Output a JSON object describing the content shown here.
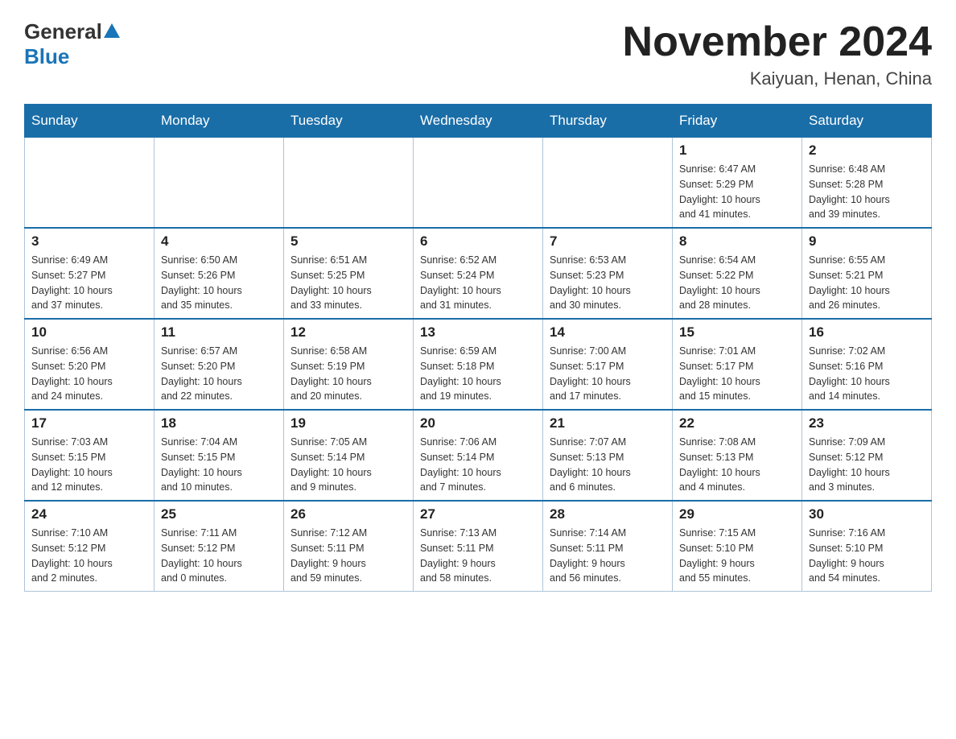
{
  "header": {
    "logo_general": "General",
    "logo_blue": "Blue",
    "title": "November 2024",
    "subtitle": "Kaiyuan, Henan, China"
  },
  "days": [
    "Sunday",
    "Monday",
    "Tuesday",
    "Wednesday",
    "Thursday",
    "Friday",
    "Saturday"
  ],
  "weeks": [
    [
      {
        "day": "",
        "info": ""
      },
      {
        "day": "",
        "info": ""
      },
      {
        "day": "",
        "info": ""
      },
      {
        "day": "",
        "info": ""
      },
      {
        "day": "",
        "info": ""
      },
      {
        "day": "1",
        "info": "Sunrise: 6:47 AM\nSunset: 5:29 PM\nDaylight: 10 hours\nand 41 minutes."
      },
      {
        "day": "2",
        "info": "Sunrise: 6:48 AM\nSunset: 5:28 PM\nDaylight: 10 hours\nand 39 minutes."
      }
    ],
    [
      {
        "day": "3",
        "info": "Sunrise: 6:49 AM\nSunset: 5:27 PM\nDaylight: 10 hours\nand 37 minutes."
      },
      {
        "day": "4",
        "info": "Sunrise: 6:50 AM\nSunset: 5:26 PM\nDaylight: 10 hours\nand 35 minutes."
      },
      {
        "day": "5",
        "info": "Sunrise: 6:51 AM\nSunset: 5:25 PM\nDaylight: 10 hours\nand 33 minutes."
      },
      {
        "day": "6",
        "info": "Sunrise: 6:52 AM\nSunset: 5:24 PM\nDaylight: 10 hours\nand 31 minutes."
      },
      {
        "day": "7",
        "info": "Sunrise: 6:53 AM\nSunset: 5:23 PM\nDaylight: 10 hours\nand 30 minutes."
      },
      {
        "day": "8",
        "info": "Sunrise: 6:54 AM\nSunset: 5:22 PM\nDaylight: 10 hours\nand 28 minutes."
      },
      {
        "day": "9",
        "info": "Sunrise: 6:55 AM\nSunset: 5:21 PM\nDaylight: 10 hours\nand 26 minutes."
      }
    ],
    [
      {
        "day": "10",
        "info": "Sunrise: 6:56 AM\nSunset: 5:20 PM\nDaylight: 10 hours\nand 24 minutes."
      },
      {
        "day": "11",
        "info": "Sunrise: 6:57 AM\nSunset: 5:20 PM\nDaylight: 10 hours\nand 22 minutes."
      },
      {
        "day": "12",
        "info": "Sunrise: 6:58 AM\nSunset: 5:19 PM\nDaylight: 10 hours\nand 20 minutes."
      },
      {
        "day": "13",
        "info": "Sunrise: 6:59 AM\nSunset: 5:18 PM\nDaylight: 10 hours\nand 19 minutes."
      },
      {
        "day": "14",
        "info": "Sunrise: 7:00 AM\nSunset: 5:17 PM\nDaylight: 10 hours\nand 17 minutes."
      },
      {
        "day": "15",
        "info": "Sunrise: 7:01 AM\nSunset: 5:17 PM\nDaylight: 10 hours\nand 15 minutes."
      },
      {
        "day": "16",
        "info": "Sunrise: 7:02 AM\nSunset: 5:16 PM\nDaylight: 10 hours\nand 14 minutes."
      }
    ],
    [
      {
        "day": "17",
        "info": "Sunrise: 7:03 AM\nSunset: 5:15 PM\nDaylight: 10 hours\nand 12 minutes."
      },
      {
        "day": "18",
        "info": "Sunrise: 7:04 AM\nSunset: 5:15 PM\nDaylight: 10 hours\nand 10 minutes."
      },
      {
        "day": "19",
        "info": "Sunrise: 7:05 AM\nSunset: 5:14 PM\nDaylight: 10 hours\nand 9 minutes."
      },
      {
        "day": "20",
        "info": "Sunrise: 7:06 AM\nSunset: 5:14 PM\nDaylight: 10 hours\nand 7 minutes."
      },
      {
        "day": "21",
        "info": "Sunrise: 7:07 AM\nSunset: 5:13 PM\nDaylight: 10 hours\nand 6 minutes."
      },
      {
        "day": "22",
        "info": "Sunrise: 7:08 AM\nSunset: 5:13 PM\nDaylight: 10 hours\nand 4 minutes."
      },
      {
        "day": "23",
        "info": "Sunrise: 7:09 AM\nSunset: 5:12 PM\nDaylight: 10 hours\nand 3 minutes."
      }
    ],
    [
      {
        "day": "24",
        "info": "Sunrise: 7:10 AM\nSunset: 5:12 PM\nDaylight: 10 hours\nand 2 minutes."
      },
      {
        "day": "25",
        "info": "Sunrise: 7:11 AM\nSunset: 5:12 PM\nDaylight: 10 hours\nand 0 minutes."
      },
      {
        "day": "26",
        "info": "Sunrise: 7:12 AM\nSunset: 5:11 PM\nDaylight: 9 hours\nand 59 minutes."
      },
      {
        "day": "27",
        "info": "Sunrise: 7:13 AM\nSunset: 5:11 PM\nDaylight: 9 hours\nand 58 minutes."
      },
      {
        "day": "28",
        "info": "Sunrise: 7:14 AM\nSunset: 5:11 PM\nDaylight: 9 hours\nand 56 minutes."
      },
      {
        "day": "29",
        "info": "Sunrise: 7:15 AM\nSunset: 5:10 PM\nDaylight: 9 hours\nand 55 minutes."
      },
      {
        "day": "30",
        "info": "Sunrise: 7:16 AM\nSunset: 5:10 PM\nDaylight: 9 hours\nand 54 minutes."
      }
    ]
  ]
}
